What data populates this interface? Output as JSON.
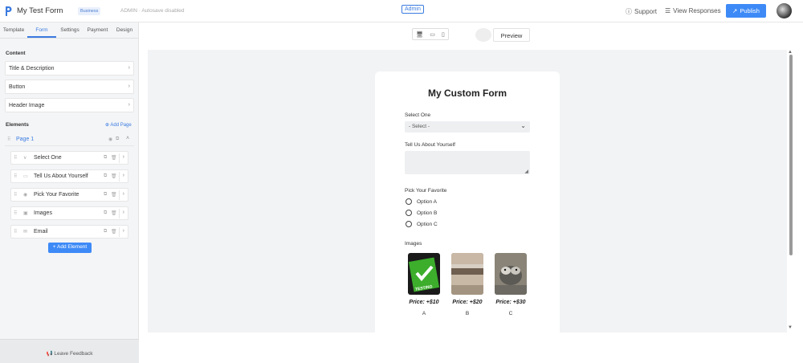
{
  "header": {
    "app_title": "My Test Form",
    "plan_badge": "Business",
    "autosave_status": "ADMIN · Autosave disabled",
    "admin_tag": "Admin",
    "support_label": "Support",
    "view_responses_label": "View Responses",
    "publish_label": "Publish"
  },
  "sidebar": {
    "tabs": [
      "Template",
      "Form",
      "Settings",
      "Payment",
      "Design"
    ],
    "active_tab": "Form",
    "content_title": "Content",
    "content_items": [
      "Title & Description",
      "Button",
      "Header Image"
    ],
    "elements_title": "Elements",
    "add_page_label": "Add Page",
    "page_label": "Page 1",
    "elements": [
      {
        "label": "Select One",
        "icon": "chevron-down-icon"
      },
      {
        "label": "Tell Us About Yourself",
        "icon": "textarea-icon"
      },
      {
        "label": "Pick Your Favorite",
        "icon": "radio-icon"
      },
      {
        "label": "Images",
        "icon": "image-icon"
      },
      {
        "label": "Email",
        "icon": "email-icon"
      }
    ],
    "add_element_label": "+ Add Element",
    "feedback_label": "Leave Feedback"
  },
  "toolbar": {
    "preview_label": "Preview"
  },
  "form": {
    "title": "My Custom Form",
    "select": {
      "label": "Select One",
      "value": "- Select -"
    },
    "textarea": {
      "label": "Tell Us About Yourself"
    },
    "radio": {
      "label": "Pick Your Favorite",
      "options": [
        "Option A",
        "Option B",
        "Option C"
      ]
    },
    "images": {
      "label": "Images",
      "items": [
        {
          "price": "Price: +$10",
          "letter": "A",
          "caption": "TESTING"
        },
        {
          "price": "Price: +$20",
          "letter": "B"
        },
        {
          "price": "Price: +$30",
          "letter": "C"
        }
      ]
    }
  },
  "colors": {
    "accent": "#3d8af7",
    "link": "#3a7be0",
    "canvas": "#f2f3f5",
    "sidebar": "#f4f5f7"
  }
}
